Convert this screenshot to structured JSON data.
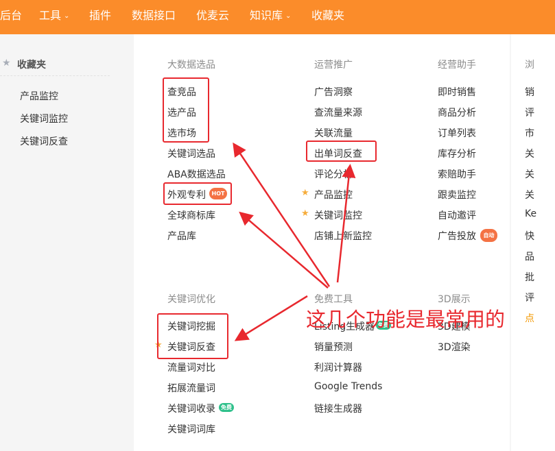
{
  "nav": {
    "items": [
      {
        "label": "后台",
        "has_dropdown": false
      },
      {
        "label": "工具",
        "has_dropdown": true
      },
      {
        "label": "插件",
        "has_dropdown": false
      },
      {
        "label": "数据接口",
        "has_dropdown": false
      },
      {
        "label": "优麦云",
        "has_dropdown": false
      },
      {
        "label": "知识库",
        "has_dropdown": true
      },
      {
        "label": "收藏夹",
        "has_dropdown": false
      }
    ]
  },
  "sidebar": {
    "title": "收藏夹",
    "items": [
      "产品监控",
      "关键词监控",
      "关键词反查"
    ]
  },
  "menu": {
    "big_data": {
      "title": "大数据选品",
      "items": [
        "查竞品",
        "选产品",
        "选市场",
        "关键词选品",
        "ABA数据选品",
        "外观专利",
        "全球商标库",
        "产品库"
      ],
      "hot_badge": "HOT"
    },
    "operations": {
      "title": "运营推广",
      "items": [
        "广告洞察",
        "查流量来源",
        "关联流量",
        "出单词反查",
        "评论分析",
        "产品监控",
        "关键词监控",
        "店铺上新监控"
      ]
    },
    "business": {
      "title": "经营助手",
      "items": [
        "即时销售",
        "商品分析",
        "订单列表",
        "库存分析",
        "索赔助手",
        "跟卖监控",
        "自动邀评",
        "广告投放"
      ],
      "auto_badge": "自动"
    },
    "keyword_opt": {
      "title": "关键词优化",
      "items": [
        "关键词挖掘",
        "关键词反查",
        "流量词对比",
        "拓展流量词",
        "关键词收录",
        "关键词词库"
      ],
      "free_badge": "免费"
    },
    "free_tools": {
      "title": "免费工具",
      "items": [
        "Listing生成器",
        "销量预测",
        "利润计算器",
        "Google Trends",
        "链接生成器"
      ]
    },
    "display3d": {
      "title": "3D展示",
      "items": [
        "3D建模",
        "3D渲染"
      ]
    }
  },
  "right_column": {
    "items": [
      "浏",
      "销",
      "评",
      "市",
      "关",
      "关",
      "关",
      "Ke",
      "快",
      "品",
      "批",
      "评",
      "点"
    ],
    "highlight_color": "#f39800"
  },
  "annotation": {
    "text": "这几个功能是最常用的",
    "color": "#e8282e"
  },
  "colors": {
    "topbar": "#fb8c2a",
    "star_gold": "#f6ad3c",
    "badge_orange": "#f47244",
    "badge_green": "#2fc08b"
  }
}
